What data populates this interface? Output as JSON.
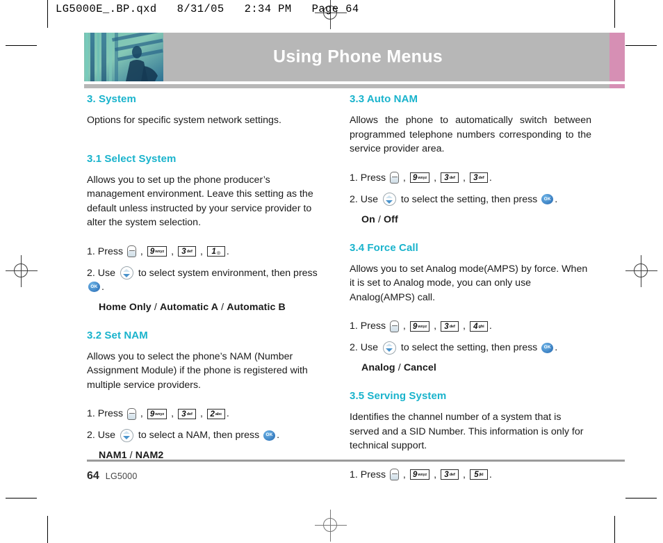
{
  "prepress": {
    "slug": "LG5000E_.BP.qxd   8/31/05   2:34 PM   Page 64"
  },
  "header": {
    "title": "Using Phone Menus",
    "accent_color": "#d68fb4",
    "bar_color": "#b7b7b7",
    "thumbnail_name": "chapter-photo-thumbnail"
  },
  "heading_color": "#19b3cc",
  "left_column": {
    "sections": [
      {
        "heading": "3. System",
        "body": "Options for specific system network settings.",
        "steps": [],
        "options": null
      },
      {
        "heading": "3.1 Select System",
        "body": "Allows you to set up the phone producer’s management environment. Leave this setting as the default unless instructed by your service provider to alter the system selection.",
        "steps": [
          {
            "index": "1.",
            "verb": "Press",
            "keys": [
              {
                "type": "menu"
              },
              {
                "type": "num",
                "digit": "9",
                "sub": "wxyz"
              },
              {
                "type": "num",
                "digit": "3",
                "sub": "def"
              },
              {
                "type": "num",
                "digit": "1",
                "sub": "☉"
              }
            ],
            "tail": "."
          },
          {
            "index": "2.",
            "verb": "Use",
            "nav": true,
            "mid": "to select system environment, then press",
            "ok": true,
            "tail": "."
          }
        ],
        "options": [
          "Home Only",
          "Automatic A",
          "Automatic B"
        ]
      },
      {
        "heading": "3.2 Set NAM",
        "body": "Allows you to select the phone’s NAM (Number Assignment Module) if the phone is registered with multiple service providers.",
        "steps": [
          {
            "index": "1.",
            "verb": "Press",
            "keys": [
              {
                "type": "menu"
              },
              {
                "type": "num",
                "digit": "9",
                "sub": "wxyz"
              },
              {
                "type": "num",
                "digit": "3",
                "sub": "def"
              },
              {
                "type": "num",
                "digit": "2",
                "sub": "abc"
              }
            ],
            "tail": "."
          },
          {
            "index": "2.",
            "verb": "Use",
            "nav": true,
            "mid": "to select a NAM, then press",
            "ok": true,
            "tail": "."
          }
        ],
        "options": [
          "NAM1",
          "NAM2"
        ]
      }
    ]
  },
  "right_column": {
    "sections": [
      {
        "heading": "3.3 Auto NAM",
        "body": "Allows the phone to automatically switch between programmed telephone numbers corresponding to the service provider area.",
        "justify": true,
        "steps": [
          {
            "index": "1.",
            "verb": "Press",
            "keys": [
              {
                "type": "menu"
              },
              {
                "type": "num",
                "digit": "9",
                "sub": "wxyz"
              },
              {
                "type": "num",
                "digit": "3",
                "sub": "def"
              },
              {
                "type": "num",
                "digit": "3",
                "sub": "def"
              }
            ],
            "tail": "."
          },
          {
            "index": "2.",
            "verb": "Use",
            "nav": true,
            "mid": "to select the setting, then press",
            "ok": true,
            "tail": "."
          }
        ],
        "options": [
          "On",
          "Off"
        ]
      },
      {
        "heading": "3.4 Force Call",
        "body": "Allows you to set Analog mode(AMPS) by force. When it is set to Analog mode, you can only use Analog(AMPS) call.",
        "justify": false,
        "steps": [
          {
            "index": "1.",
            "verb": "Press",
            "keys": [
              {
                "type": "menu"
              },
              {
                "type": "num",
                "digit": "9",
                "sub": "wxyz"
              },
              {
                "type": "num",
                "digit": "3",
                "sub": "def"
              },
              {
                "type": "num",
                "digit": "4",
                "sub": "ghi"
              }
            ],
            "tail": "."
          },
          {
            "index": "2.",
            "verb": "Use",
            "nav": true,
            "mid": "to select the setting, then press",
            "ok": true,
            "tail": "."
          }
        ],
        "options": [
          "Analog",
          "Cancel"
        ]
      },
      {
        "heading": "3.5 Serving System",
        "body": "Identifies the channel number of a system that is served and a SID Number. This information is only for technical support.",
        "justify": false,
        "steps": [
          {
            "index": "1.",
            "verb": "Press",
            "keys": [
              {
                "type": "menu"
              },
              {
                "type": "num",
                "digit": "9",
                "sub": "wxyz"
              },
              {
                "type": "num",
                "digit": "3",
                "sub": "def"
              },
              {
                "type": "num",
                "digit": "5",
                "sub": "jkl"
              }
            ],
            "tail": "."
          }
        ],
        "options": null
      }
    ]
  },
  "footer": {
    "page_number": "64",
    "model": "LG5000"
  },
  "ok_label": "OK",
  "separator": ","
}
